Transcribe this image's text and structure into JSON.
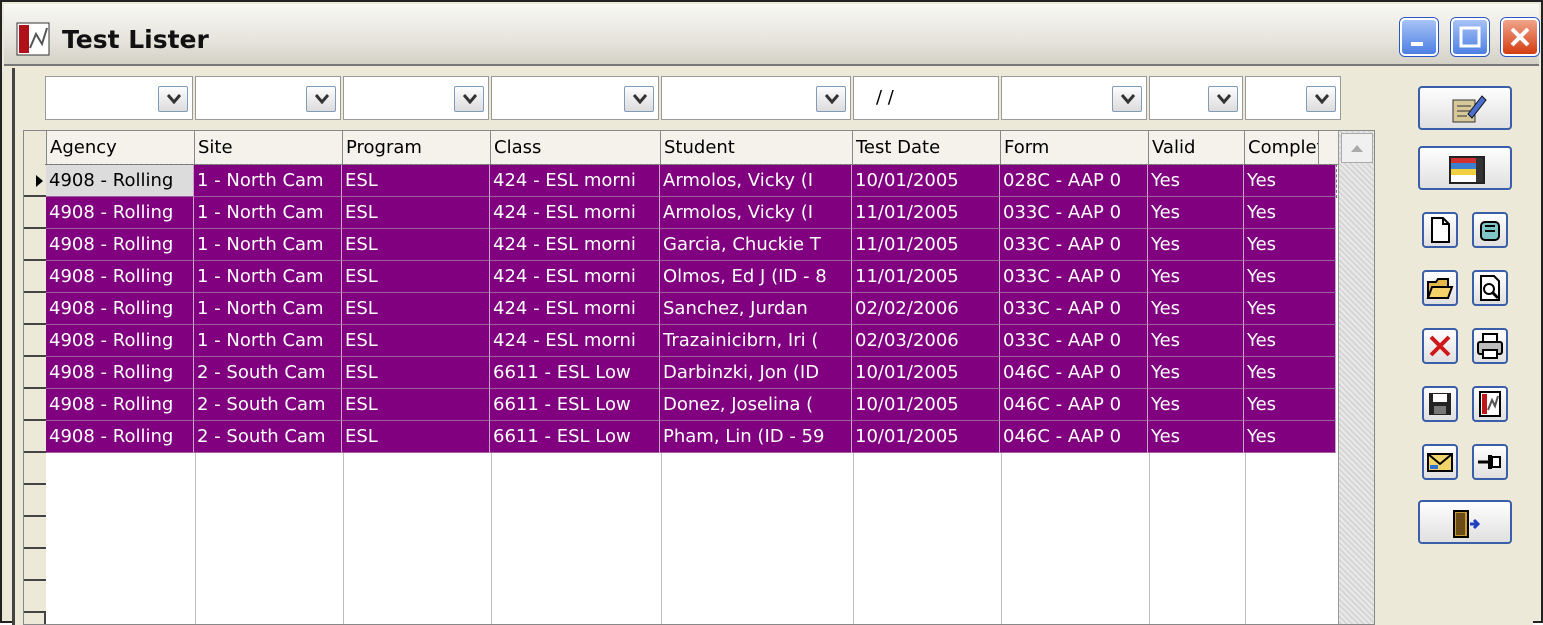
{
  "window": {
    "title": "Test Lister"
  },
  "filters": {
    "test_date_placeholder": " / /"
  },
  "columns": [
    "Agency",
    "Site",
    "Program",
    "Class",
    "Student",
    "Test Date",
    "Form",
    "Valid",
    "Complete"
  ],
  "rows": [
    {
      "agency": "4908 - Rolling",
      "site": "1 - North Cam",
      "program": "ESL",
      "class": "424 - ESL morni",
      "student": "Armolos, Vicky  (I",
      "test_date": "10/01/2005",
      "form": "028C - AAP 0",
      "valid": "Yes",
      "complete": "Yes"
    },
    {
      "agency": "4908 - Rolling",
      "site": "1 - North Cam",
      "program": "ESL",
      "class": "424 - ESL morni",
      "student": "Armolos, Vicky  (I",
      "test_date": "11/01/2005",
      "form": "033C - AAP 0",
      "valid": "Yes",
      "complete": "Yes"
    },
    {
      "agency": "4908 - Rolling",
      "site": "1 - North Cam",
      "program": "ESL",
      "class": "424 - ESL morni",
      "student": "Garcia, Chuckie T",
      "test_date": "11/01/2005",
      "form": "033C - AAP 0",
      "valid": "Yes",
      "complete": "Yes"
    },
    {
      "agency": "4908 - Rolling",
      "site": "1 - North Cam",
      "program": "ESL",
      "class": "424 - ESL morni",
      "student": "Olmos, Ed J (ID - 8",
      "test_date": "11/01/2005",
      "form": "033C - AAP 0",
      "valid": "Yes",
      "complete": "Yes"
    },
    {
      "agency": "4908 - Rolling",
      "site": "1 - North Cam",
      "program": "ESL",
      "class": "424 - ESL morni",
      "student": "Sanchez, Jurdan",
      "test_date": "02/02/2006",
      "form": "033C - AAP 0",
      "valid": "Yes",
      "complete": "Yes"
    },
    {
      "agency": "4908 - Rolling",
      "site": "1 - North Cam",
      "program": "ESL",
      "class": "424 - ESL morni",
      "student": "Trazainicibrn, Iri  (",
      "test_date": "02/03/2006",
      "form": "033C - AAP 0",
      "valid": "Yes",
      "complete": "Yes"
    },
    {
      "agency": "4908 - Rolling",
      "site": "2 - South Cam",
      "program": "ESL",
      "class": "6611 - ESL Low",
      "student": "Darbinzki, Jon  (ID",
      "test_date": "10/01/2005",
      "form": "046C - AAP 0",
      "valid": "Yes",
      "complete": "Yes"
    },
    {
      "agency": "4908 - Rolling",
      "site": "2 - South Cam",
      "program": "ESL",
      "class": "6611 - ESL Low",
      "student": "Donez, Joselina  (",
      "test_date": "10/01/2005",
      "form": "046C - AAP 0",
      "valid": "Yes",
      "complete": "Yes"
    },
    {
      "agency": "4908 - Rolling",
      "site": "2 - South Cam",
      "program": "ESL",
      "class": "6611 - ESL Low",
      "student": "Pham, Lin  (ID - 59",
      "test_date": "10/01/2005",
      "form": "046C - AAP 0",
      "valid": "Yes",
      "complete": "Yes"
    }
  ],
  "colors": {
    "selection": "#800080",
    "selection_text": "#ffffff",
    "window_face": "#ece9d8"
  },
  "toolbar": {
    "icons": [
      "edit-icon",
      "layout-icon",
      "new-document-icon",
      "copy-document-icon",
      "open-folder-icon",
      "print-preview-icon",
      "delete-icon",
      "print-icon",
      "save-icon",
      "report-icon",
      "email-icon",
      "pin-icon",
      "exit-icon"
    ]
  }
}
